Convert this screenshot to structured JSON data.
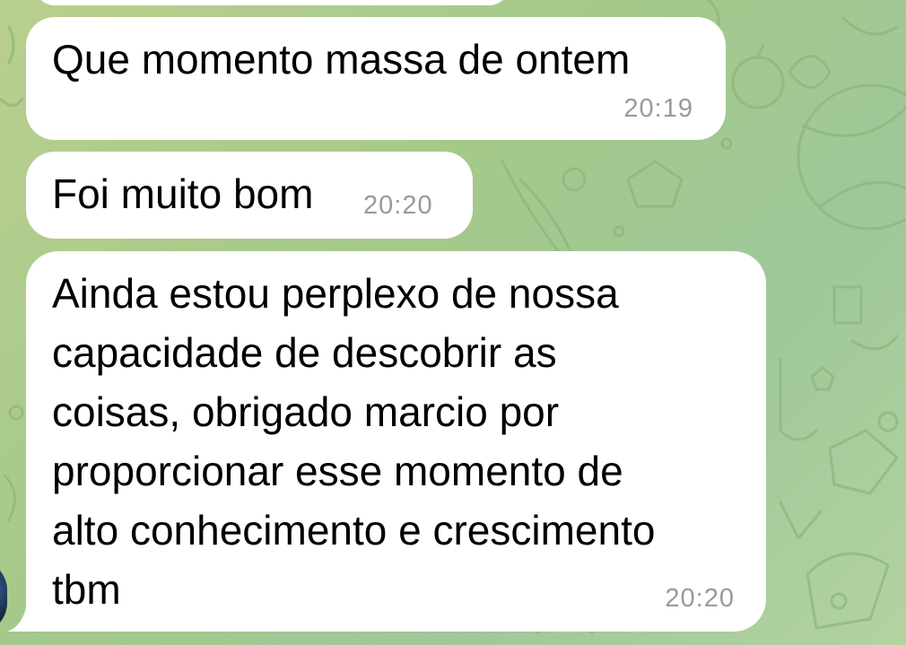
{
  "chat": {
    "messages": [
      {
        "text": "Que momento massa de ontem",
        "time": "20:19"
      },
      {
        "text": "Foi muito bom",
        "time": "20:20"
      },
      {
        "lines": [
          "Ainda estou perplexo de nossa",
          "capacidade de descobrir as",
          "coisas, obrigado marcio por",
          "proporcionar esse momento de",
          "alto conhecimento e crescimento",
          "tbm"
        ],
        "time": "20:20"
      }
    ]
  },
  "colors": {
    "bubble": "#ffffff",
    "timestamp": "#9a9a9a",
    "wallpaper": "#a5c98a"
  },
  "icons": {
    "wallpaper": "doodle-pattern",
    "sender": "avatar"
  }
}
